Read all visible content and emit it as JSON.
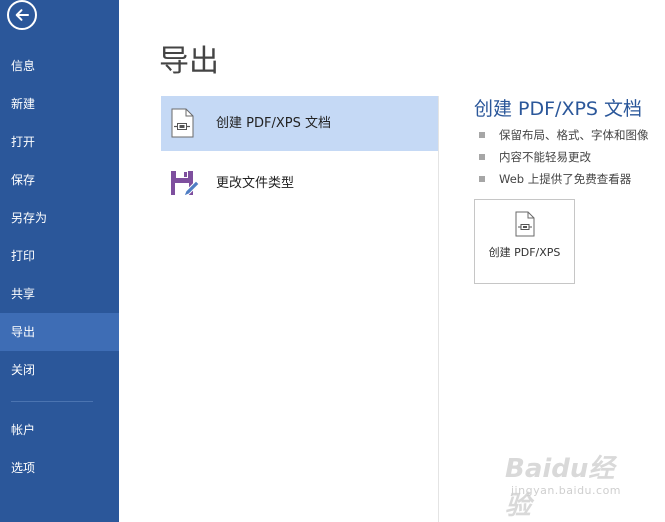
{
  "sidebar": {
    "back_icon": "back-arrow-icon",
    "items": [
      {
        "id": "info",
        "label": "信息"
      },
      {
        "id": "new",
        "label": "新建"
      },
      {
        "id": "open",
        "label": "打开"
      },
      {
        "id": "save",
        "label": "保存"
      },
      {
        "id": "save-as",
        "label": "另存为"
      },
      {
        "id": "print",
        "label": "打印"
      },
      {
        "id": "share",
        "label": "共享"
      },
      {
        "id": "export",
        "label": "导出"
      },
      {
        "id": "close",
        "label": "关闭"
      },
      {
        "id": "account",
        "label": "帐户"
      },
      {
        "id": "options",
        "label": "选项"
      }
    ],
    "active": "export"
  },
  "main": {
    "title": "导出",
    "options": [
      {
        "label": "创建 PDF/XPS 文档",
        "icon": "pdf-document-icon",
        "selected": true
      },
      {
        "label": "更改文件类型",
        "icon": "save-as-file-type-icon",
        "selected": false
      }
    ]
  },
  "panel": {
    "title": "创建 PDF/XPS 文档",
    "bullets": [
      "保留布局、格式、字体和图像",
      "内容不能轻易更改",
      "Web 上提供了免费查看器"
    ],
    "button_label": "创建 PDF/XPS",
    "button_icon": "pdf-document-icon"
  },
  "watermark": {
    "logo": "Baidu经验",
    "url": "jingyan.baidu.com"
  },
  "colors": {
    "sidebar_bg": "#2b579a",
    "sidebar_active": "#3e6db5",
    "selected_option": "#c5d9f5",
    "accent_text": "#2b579a"
  }
}
